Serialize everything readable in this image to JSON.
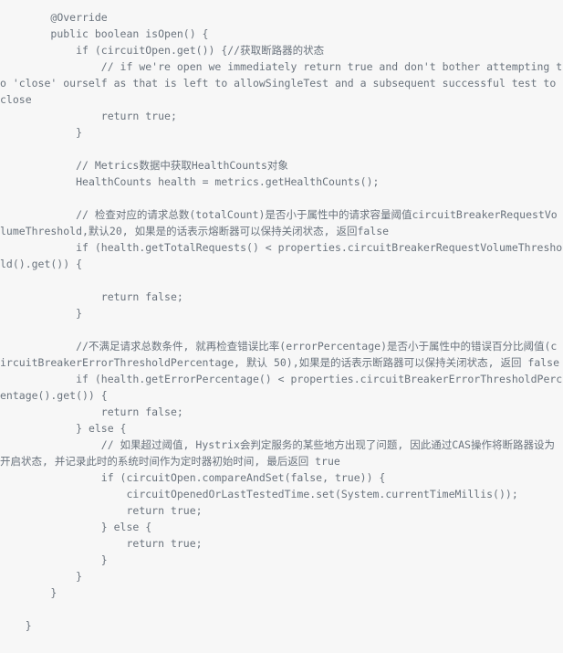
{
  "page": {
    "kind": "source-code-listing",
    "language": "java",
    "background_color": "#f7f7f7",
    "text_color": "#6a737d"
  },
  "code": {
    "text": "        @Override\n        public boolean isOpen() {\n            if (circuitOpen.get()) {//获取断路器的状态\n                // if we're open we immediately return true and don't bother attempting to 'close' ourself as that is left to allowSingleTest and a subsequent successful test to close\n                return true;\n            }\n\n            // Metrics数据中获取HealthCounts对象\n            HealthCounts health = metrics.getHealthCounts();\n\n            // 检查对应的请求总数(totalCount)是否小于属性中的请求容量阈值circuitBreakerRequestVolumeThreshold,默认20, 如果是的话表示熔断器可以保持关闭状态, 返回false\n            if (health.getTotalRequests() < properties.circuitBreakerRequestVolumeThreshold().get()) {\n\n                return false;\n            }\n\n            //不满足请求总数条件, 就再检查错误比率(errorPercentage)是否小于属性中的错误百分比阈值(circuitBreakerErrorThresholdPercentage, 默认 50),如果是的话表示断路器可以保持关闭状态, 返回 false\n            if (health.getErrorPercentage() < properties.circuitBreakerErrorThresholdPercentage().get()) {\n                return false;\n            } else {\n                // 如果超过阈值, Hystrix会判定服务的某些地方出现了问题, 因此通过CAS操作将断路器设为开启状态, 并记录此时的系统时间作为定时器初始时间, 最后返回 true\n                if (circuitOpen.compareAndSet(false, true)) {\n                    circuitOpenedOrLastTestedTime.set(System.currentTimeMillis());\n                    return true;\n                } else {\n                    return true;\n                }\n            }\n        }\n\n    }"
  }
}
